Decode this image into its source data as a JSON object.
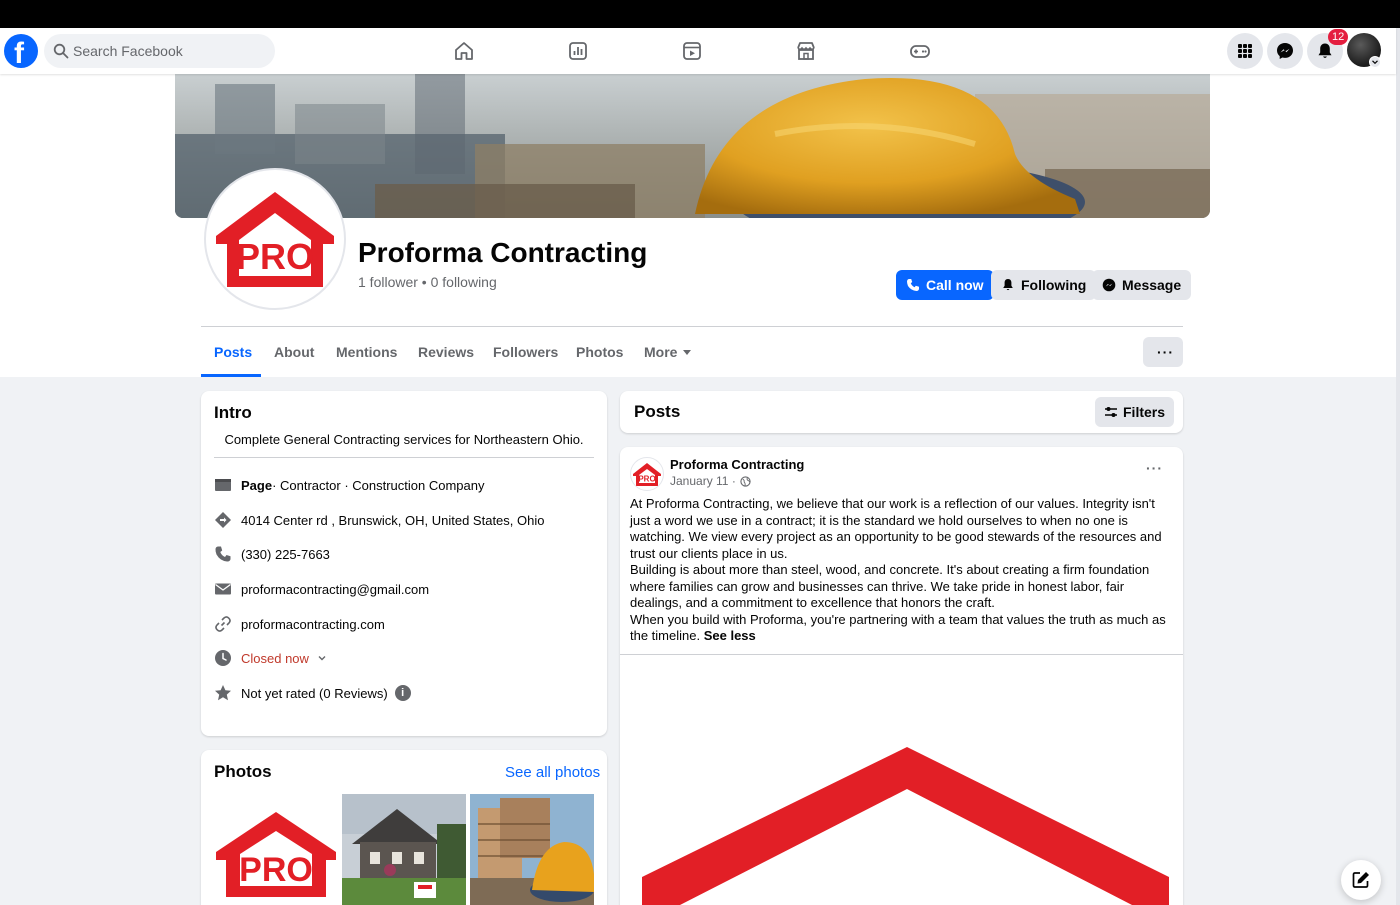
{
  "nav": {
    "logo_letter": "f",
    "search_placeholder": "Search Facebook",
    "icons": [
      "home-icon",
      "dashboard-icon",
      "video-icon",
      "marketplace-icon",
      "gaming-icon"
    ],
    "notification_count": "12",
    "brand_color": "#0866ff"
  },
  "page": {
    "name": "Proforma Contracting",
    "stats": "1 follower • 0 following",
    "logo_text": "PRO",
    "logo_color": "#e21f26"
  },
  "actions": {
    "call": "Call now",
    "following": "Following",
    "message": "Message"
  },
  "tabs": [
    "Posts",
    "About",
    "Mentions",
    "Reviews",
    "Followers",
    "Photos",
    "More"
  ],
  "intro": {
    "title": "Intro",
    "description": "Complete General Contracting services for Northeastern Ohio.",
    "category_label": "Page",
    "category": " · Contractor · Construction Company",
    "address": "4014 Center rd , Brunswick, OH, United States, Ohio",
    "phone": "(330) 225-7663",
    "email": "proformacontracting@gmail.com",
    "website": "proformacontracting.com",
    "hours": "Closed now",
    "rating": "Not yet rated (0 Reviews)"
  },
  "photos": {
    "title": "Photos",
    "see_all": "See all photos"
  },
  "posts": {
    "title": "Posts",
    "filters": "Filters",
    "post": {
      "author": "Proforma Contracting",
      "date": "January 11 ·",
      "paragraphs": [
        "At Proforma Contracting, we believe that our work is a reflection of our values. Integrity isn't just a word we use in a contract; it is the standard we hold ourselves to when no one is watching. We view every project as an opportunity to be good stewards of the resources and trust our clients place in us.",
        "Building is about more than steel, wood, and concrete. It's about creating a firm foundation where families can grow and businesses can thrive. We take pride in honest labor, fair dealings, and a commitment to excellence that honors the craft.",
        "When you build with Proforma, you're partnering with a team that values the truth as much as the timeline."
      ],
      "see_less": "See less"
    }
  }
}
